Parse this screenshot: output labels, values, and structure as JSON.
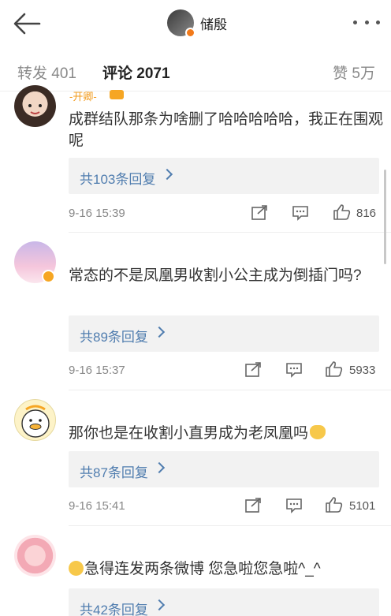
{
  "header": {
    "author_name": "储殷",
    "icons": {
      "back": "back-arrow-icon",
      "more": "more-dots-icon"
    }
  },
  "tabs": {
    "repost": "转发 401",
    "comment": "评论 2071",
    "like": "赞 5万"
  },
  "comments": [
    {
      "name": "-开卿-",
      "text": "成群结队那条为啥删了哈哈哈哈哈，我正在围观呢",
      "reply_label": "共103条回复",
      "time": "9-16 15:39",
      "likes": "816"
    },
    {
      "name": "",
      "text": "常态的不是凤凰男收割小公主成为倒插门吗?",
      "reply_label": "共89条回复",
      "time": "9-16 15:37",
      "likes": "5933"
    },
    {
      "name": "",
      "text": "那你也是在收割小直男成为老凤凰吗",
      "reply_label": "共87条回复",
      "time": "9-16 15:41",
      "likes": "5101"
    },
    {
      "name": "",
      "text": "急得连发两条微博 您急啦您急啦^_^",
      "reply_label": "共42条回复",
      "time": "",
      "likes": ""
    }
  ],
  "colors": {
    "accent": "#f6a623",
    "link": "#507daf",
    "reply_bg": "#f2f2f2"
  }
}
